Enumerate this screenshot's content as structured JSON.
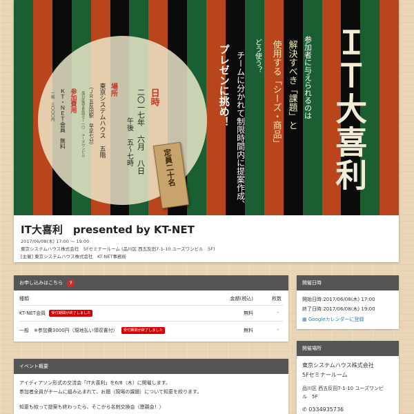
{
  "hero": {
    "title": "ＩＴ大喜利",
    "intro_1": "参加者に与えられるのは",
    "intro_2": "解決すべき「課題」と",
    "intro_3": "使用する「シーズ・商品」",
    "how": "どう使う？",
    "team_1": "チームに分かれて制限時間内に提案作成、",
    "team_2": "プレゼンに挑め！",
    "date_heading": "日時",
    "date_value": "二〇一七年 六月 八日",
    "time_value": "午後 五〜七時",
    "place_heading": "場所",
    "place_value": "東京システムハウス 五階",
    "place_access": "（ＪＲ五反田駅 早足七分）",
    "place_address": "品川区西五反田七ー一〇 ユーズワンビル",
    "fee_heading": "参加費用",
    "fee_member": "ＫＴ・ＮＥＴ会員　無料",
    "fee_general": "一般　三〇〇〇円",
    "capacity": "定員二十名",
    "stripe_colors": [
      "#1a5e32",
      "#b8451c",
      "#0b0b0b",
      "#1a5e32",
      "#b8451c",
      "#0b0b0b",
      "#1a5e32",
      "#b8451c",
      "#0b0b0b",
      "#1a5e32",
      "#b8451c",
      "#0b0b0b",
      "#1a5e32",
      "#b8451c",
      "#0b0b0b",
      "#1a5e32",
      "#b8451c",
      "#0b0b0b",
      "#1a5e32",
      "#b8451c"
    ]
  },
  "event": {
    "title": "IT大喜利　presented by KT-NET",
    "datetime": "2017/06/08(木) 17:00 〜 19:00",
    "venue": "東京システムハウス株式会社　5Fセミナールーム (品川区 西五反田7-1-10 ユーズワンビル　5F)",
    "organizer": "[主催] 東京システムハウス株式会社　KT-NET事務局"
  },
  "apply": {
    "header": "お申し込みはこちら",
    "help": "?",
    "col_type": "種類",
    "col_price": "金額(税込)",
    "col_count": "枚数",
    "rows": [
      {
        "type": "KT-NET会員",
        "badge": "受付期間が終了しました",
        "price": "無料",
        "count": "-"
      },
      {
        "type": "一般　※参加費3000円（現地払い領収書付）",
        "badge": "受付期間が終了しました",
        "price": "無料",
        "count": "-"
      }
    ]
  },
  "schedule": {
    "header": "開催日時",
    "start": "開始日時:2017/06/08(木) 17:00",
    "end": "終了日時:2017/06/08(木) 19:00",
    "calendar_link": "Googleカレンダーに登録"
  },
  "place": {
    "header": "開催場所",
    "name_1": "東京システムハウス株式会社",
    "name_2": "5Fセミナールーム",
    "address_1": "品川区 西五反田7-1-10 ユーズワンビ",
    "address_2": "ル　5F",
    "phone": "0334935736"
  },
  "overview": {
    "header": "イベント概要",
    "line1": "アイディアソン形式の交流会「IT大喜利」を6/8（木）に開催します。",
    "line2": "参加者全員がチームに組み込まれて、お題（現場の課題）について知恵を絞ります。",
    "line3": "知恵も絞って提案も終わったら、そこから名刺交換会（懇親会！）"
  },
  "colors": {
    "accent": "#d40000",
    "link": "#2a7ab0",
    "header_bg": "#555555"
  }
}
